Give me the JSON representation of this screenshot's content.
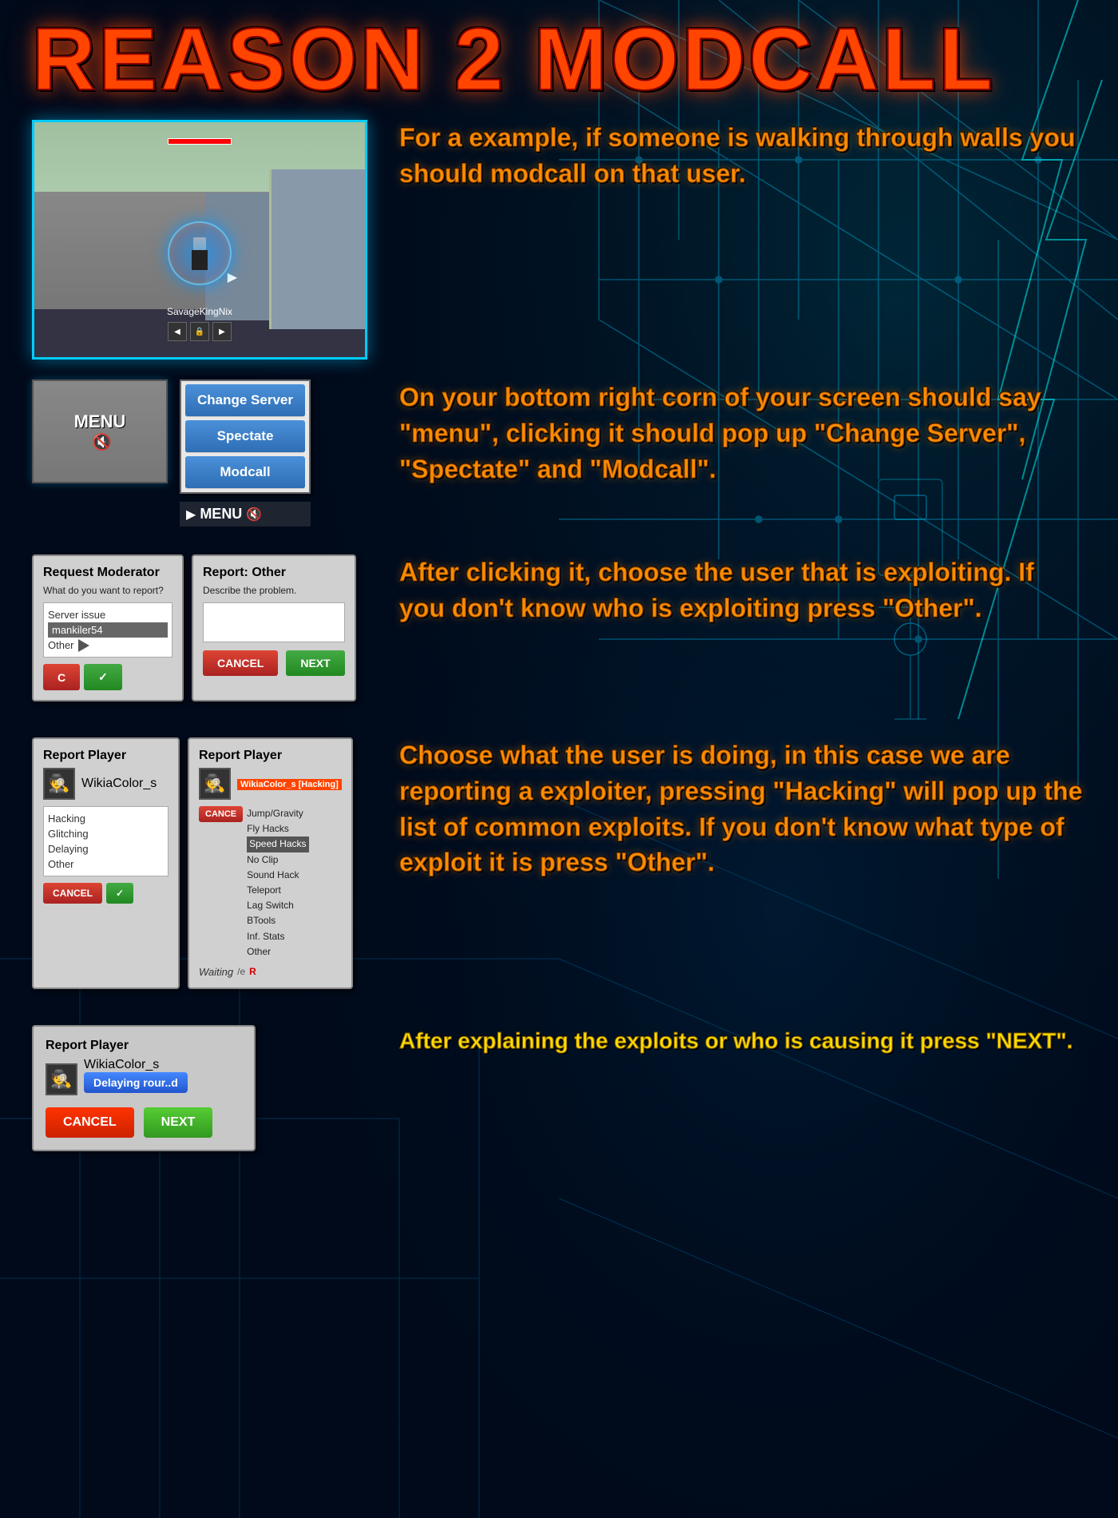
{
  "title": "REASON 2 MODCALL",
  "colors": {
    "title": "#ff4500",
    "accent_orange": "#ff8c00",
    "accent_yellow": "#ffdd00",
    "bg": "#000a1a",
    "neon_cyan": "#00ccff"
  },
  "section1": {
    "text": "For a example, if someone is walking through walls you should modcall on that user."
  },
  "section2": {
    "text": "On your bottom right corn of your screen should say \"menu\", clicking it should pop up \"Change Server\", \"Spectate\" and \"Modcall\"."
  },
  "section3": {
    "text": "After clicking it, choose the user that is exploiting. If you don't know who is exploiting press \"Other\"."
  },
  "section4": {
    "text": "Choose what the user is doing, in this case we are reporting a exploiter, pressing \"Hacking\" will pop up the list of common exploits. If you don't know what type of exploit it is press \"Other\"."
  },
  "section5": {
    "text": "After explaining the exploits or who is causing it press \"NEXT\"."
  },
  "menu_items": [
    "Change Server",
    "Spectate",
    "Modcall"
  ],
  "menu_label": "MENU",
  "report_dialog1": {
    "title": "Request Moderator",
    "subtitle": "What do you want to report?",
    "items": [
      "Server issue",
      "mankiler54",
      "Other"
    ],
    "selected": "mankiler54"
  },
  "report_dialog2": {
    "title": "Report: Other",
    "subtitle": "Describe the problem.",
    "cancel": "CANCEL",
    "next": "NEXT"
  },
  "report_player1": {
    "title": "Report Player",
    "username": "WikiaColor_s",
    "options": [
      "Hacking",
      "Glitching",
      "Delaying",
      "Other"
    ],
    "cancel": "CANCEL"
  },
  "report_player2": {
    "title": "Report Player",
    "username": "WikiaColor_s [Hacking]",
    "options": [
      "Jump/Gravity",
      "Fly Hacks",
      "Speed Hacks",
      "No Clip",
      "Sound Hack",
      "Teleport",
      "Lag Switch",
      "BTools",
      "Inf. Stats",
      "Other"
    ],
    "cancel": "CANCE",
    "waiting": "Waiting"
  },
  "report_player3": {
    "title": "Report Player",
    "username": "WikiaColor_s",
    "tag": "Delaying rour..d",
    "cancel": "CANCEL",
    "next": "NEXT"
  },
  "nav": {
    "username": "SavageKingNix"
  }
}
